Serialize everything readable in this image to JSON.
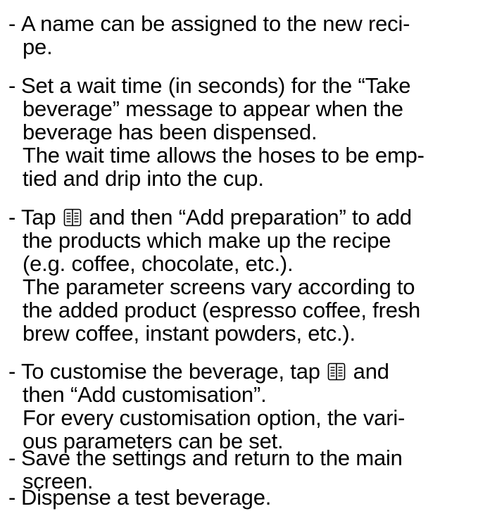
{
  "items": [
    {
      "dash": "-",
      "lines": [
        "A name can be assigned to the new reci-",
        "pe."
      ]
    },
    {
      "dash": "-",
      "lines": [
        "Set a wait time (in seconds) for the “Take",
        "beverage” message to appear when the",
        "beverage has been dispensed.",
        "The wait time allows the hoses to be emp-",
        "tied and drip into the cup."
      ]
    },
    {
      "dash": "-",
      "line1_before_icon": "Tap",
      "line1_after_icon": "and then “Add preparation” to add",
      "lines": [
        "the products which make up the recipe",
        "(e.g. coffee, chocolate, etc.).",
        "The parameter screens vary according to",
        "the added product (espresso coffee, fresh",
        "brew coffee, instant powders, etc.)."
      ]
    },
    {
      "dash": "-",
      "line1_before_icon": "To customise the beverage, tap",
      "line1_after_icon": "and",
      "lines": [
        "then “Add customisation”.",
        "For every customisation option, the vari-",
        "ous parameters can be set."
      ]
    },
    {
      "dash": "-",
      "lines": [
        "Save the settings and return to the main",
        "screen."
      ]
    },
    {
      "dash": "-",
      "lines": [
        "Dispense a test beverage."
      ]
    }
  ],
  "icons": {
    "menu": "book-menu-icon"
  }
}
